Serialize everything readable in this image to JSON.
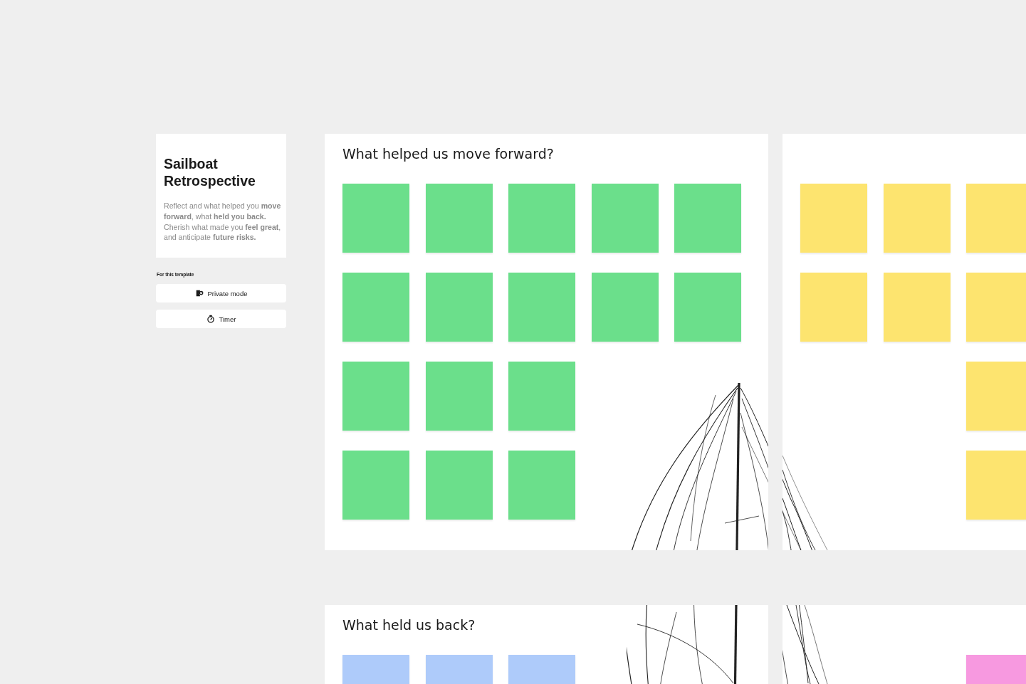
{
  "template_card": {
    "title": "Sailboat Retrospective",
    "description": "Reflect and what helped you **move forward**, what **held you back.** Cherish what made you **feel great**, and anticipate **future risks.**"
  },
  "template_tools": {
    "heading": "For this template",
    "buttons": [
      {
        "kind": "private",
        "label": "Private mode"
      },
      {
        "kind": "timer",
        "label": "Timer"
      }
    ]
  },
  "frames": [
    {
      "title": "What helped us move forward?",
      "rows": [
        [
          {
            "kind": "note",
            "color": "#6bdf8b"
          },
          {
            "kind": "note",
            "color": "#6bdf8b"
          },
          {
            "kind": "note",
            "color": "#6bdf8b"
          },
          {
            "kind": "note",
            "color": "#6bdf8b"
          },
          {
            "kind": "note",
            "color": "#6bdf8b"
          }
        ],
        [
          {
            "kind": "note",
            "color": "#6bdf8b"
          },
          {
            "kind": "note",
            "color": "#6bdf8b"
          },
          {
            "kind": "note",
            "color": "#6bdf8b"
          },
          {
            "kind": "note",
            "color": "#6bdf8b"
          },
          {
            "kind": "note",
            "color": "#6bdf8b"
          }
        ],
        [
          {
            "kind": "note",
            "color": "#6bdf8b"
          },
          {
            "kind": "note",
            "color": "#6bdf8b"
          },
          {
            "kind": "note",
            "color": "#6bdf8b"
          }
        ],
        [
          {
            "kind": "note",
            "color": "#6bdf8b"
          },
          {
            "kind": "note",
            "color": "#6bdf8b"
          },
          {
            "kind": "note",
            "color": "#6bdf8b"
          }
        ]
      ]
    },
    {
      "rows": [
        [
          {
            "kind": "note",
            "color": "#fde46f"
          },
          {
            "kind": "note",
            "color": "#fde46f"
          },
          {
            "kind": "note",
            "color": "#fde46f"
          }
        ],
        [
          {
            "kind": "note",
            "color": "#fde46f"
          },
          {
            "kind": "note",
            "color": "#fde46f"
          },
          {
            "kind": "note",
            "color": "#fde46f"
          }
        ],
        [
          {
            "kind": "empty"
          },
          {
            "kind": "empty"
          },
          {
            "kind": "note",
            "color": "#fde46f"
          }
        ],
        [
          {
            "kind": "empty"
          },
          {
            "kind": "empty"
          },
          {
            "kind": "note",
            "color": "#fde46f"
          }
        ]
      ]
    },
    {
      "title": "What held us back?",
      "rows": [
        [
          {
            "kind": "note",
            "color": "#aecbfa"
          },
          {
            "kind": "note",
            "color": "#aecbfa"
          },
          {
            "kind": "note",
            "color": "#aecbfa"
          }
        ]
      ]
    },
    {
      "rows": [
        [
          {
            "kind": "empty"
          },
          {
            "kind": "empty"
          },
          {
            "kind": "note",
            "color": "#f799e0"
          }
        ]
      ]
    }
  ]
}
